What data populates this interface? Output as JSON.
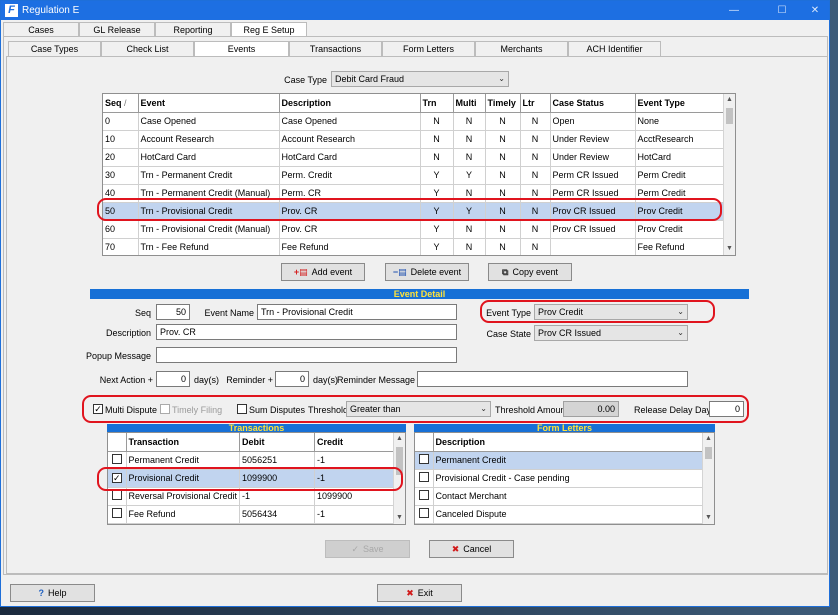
{
  "window": {
    "title": "Regulation E",
    "app_icon": "F"
  },
  "top_tabs": [
    "Cases",
    "GL Release",
    "Reporting",
    "Reg E Setup"
  ],
  "sub_tabs": [
    "Case Types",
    "Check List",
    "Events",
    "Transactions",
    "Form Letters",
    "Merchants",
    "ACH Identifier"
  ],
  "case_type": {
    "label": "Case Type",
    "value": "Debit Card Fraud"
  },
  "events_grid": {
    "headers": [
      "Seq",
      "Event",
      "Description",
      "Trn",
      "Multi",
      "Timely",
      "Ltr",
      "Case Status",
      "Event Type"
    ],
    "sort_glyph": "/",
    "rows": [
      [
        "0",
        "Case Opened",
        "Case Opened",
        "N",
        "N",
        "N",
        "N",
        "Open",
        "None"
      ],
      [
        "10",
        "Account Research",
        "Account Research",
        "N",
        "N",
        "N",
        "N",
        "Under Review",
        "AcctResearch"
      ],
      [
        "20",
        "HotCard Card",
        "HotCard Card",
        "N",
        "N",
        "N",
        "N",
        "Under Review",
        "HotCard"
      ],
      [
        "30",
        "Trn - Permanent Credit",
        "Perm. Credit",
        "Y",
        "Y",
        "N",
        "N",
        "Perm CR Issued",
        "Perm Credit"
      ],
      [
        "40",
        "Trn - Permanent Credit (Manual)",
        "Perm. CR",
        "Y",
        "N",
        "N",
        "N",
        "Perm CR Issued",
        "Perm Credit"
      ],
      [
        "50",
        "Trn - Provisional Credit",
        "Prov. CR",
        "Y",
        "Y",
        "N",
        "N",
        "Prov CR Issued",
        "Prov Credit"
      ],
      [
        "60",
        "Trn - Provisional Credit (Manual)",
        "Prov. CR",
        "Y",
        "N",
        "N",
        "N",
        "Prov CR Issued",
        "Prov Credit"
      ],
      [
        "70",
        "Trn - Fee Refund",
        "Fee Refund",
        "Y",
        "N",
        "N",
        "N",
        "",
        "Fee Refund"
      ]
    ]
  },
  "buttons": {
    "add_event": "Add event",
    "delete_event": "Delete event",
    "copy_event": "Copy event",
    "save": "Save",
    "cancel": "Cancel",
    "help": "Help",
    "exit": "Exit"
  },
  "event_detail": {
    "title": "Event Detail",
    "seq_label": "Seq",
    "seq_value": "50",
    "event_name_label": "Event Name",
    "event_name_value": "Trn - Provisional Credit",
    "description_label": "Description",
    "description_value": "Prov. CR",
    "popup_label": "Popup Message",
    "popup_value": "",
    "next_action_label": "Next Action +",
    "next_action_value": "0",
    "next_action_unit": "day(s)",
    "reminder_label": "Reminder +",
    "reminder_value": "0",
    "reminder_unit": "day(s)",
    "reminder_msg_label": "Reminder Message",
    "reminder_msg_value": "",
    "event_type_label": "Event Type",
    "event_type_value": "Prov Credit",
    "case_state_label": "Case State",
    "case_state_value": "Prov CR Issued",
    "multi_dispute_label": "Multi Dispute",
    "timely_filing_label": "Timely Filing",
    "sum_disputes_label": "Sum Disputes",
    "threshold_label": "Threshold",
    "threshold_value": "Greater than",
    "threshold_amount_label": "Threshold Amount",
    "threshold_amount_value": "0.00",
    "release_delay_label": "Release Delay Days",
    "release_delay_value": "0"
  },
  "transactions": {
    "title": "Transactions",
    "headers": [
      "Transaction",
      "Debit",
      "Credit"
    ],
    "rows": [
      {
        "checked": false,
        "cells": [
          "Permanent Credit",
          "5056251",
          "-1"
        ]
      },
      {
        "checked": true,
        "cells": [
          "Provisional Credit",
          "1099900",
          "-1"
        ]
      },
      {
        "checked": false,
        "cells": [
          "Reversal Provisional Credit",
          "-1",
          "1099900"
        ]
      },
      {
        "checked": false,
        "cells": [
          "Fee Refund",
          "5056434",
          "-1"
        ]
      }
    ]
  },
  "form_letters": {
    "title": "Form Letters",
    "header": "Description",
    "rows": [
      "Permanent Credit",
      "Provisional Credit - Case pending",
      "Contact Merchant",
      "Canceled Dispute"
    ]
  },
  "colors": {
    "title_bar": "#1d6fe2",
    "section_bar": "#1770d6",
    "section_text": "#ffe23a",
    "selection": "#c1d4ef",
    "highlight": "#e0141e"
  }
}
